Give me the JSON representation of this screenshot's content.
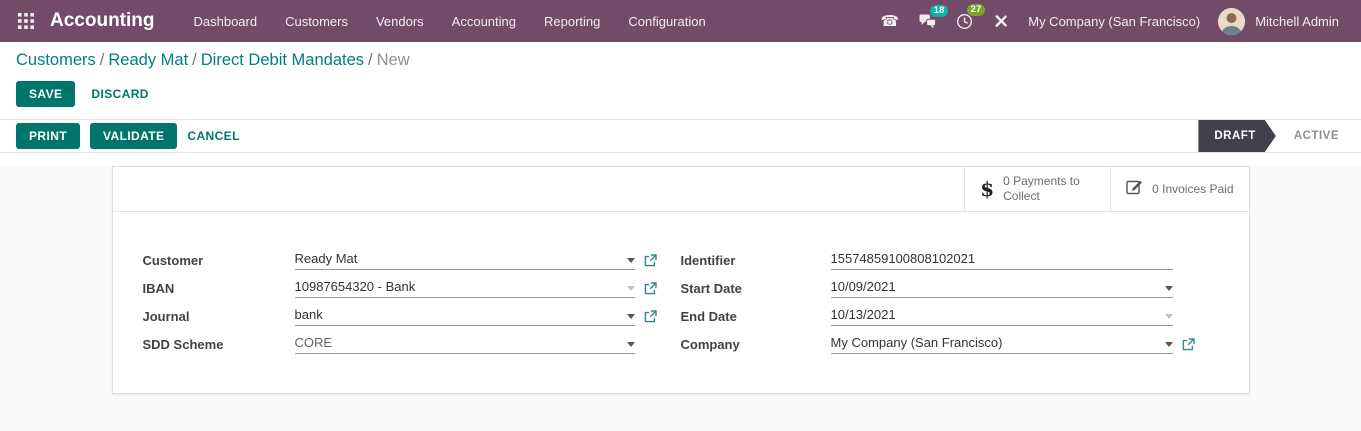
{
  "navbar": {
    "app_name": "Accounting",
    "menus": [
      "Dashboard",
      "Customers",
      "Vendors",
      "Accounting",
      "Reporting",
      "Configuration"
    ],
    "badges": {
      "messages": "18",
      "activities": "27"
    },
    "company": "My Company (San Francisco)",
    "user": "Mitchell Admin"
  },
  "breadcrumb": {
    "links": [
      "Customers",
      "Ready Mat",
      "Direct Debit Mandates"
    ],
    "current": "New"
  },
  "form_actions": {
    "save": "SAVE",
    "discard": "DISCARD"
  },
  "statusbar": {
    "print": "PRINT",
    "validate": "VALIDATE",
    "cancel": "CANCEL",
    "states": {
      "draft": "DRAFT",
      "active": "ACTIVE"
    }
  },
  "stat_buttons": [
    {
      "icon": "dollar-icon",
      "label": "0 Payments to Collect"
    },
    {
      "icon": "edit-pencil-icon",
      "label": "0 Invoices Paid"
    }
  ],
  "fields": {
    "customer": {
      "label": "Customer",
      "value": "Ready Mat"
    },
    "iban": {
      "label": "IBAN",
      "value": "10987654320 - Bank"
    },
    "journal": {
      "label": "Journal",
      "value": "bank"
    },
    "sdd_scheme": {
      "label": "SDD Scheme",
      "value": "CORE"
    },
    "identifier": {
      "label": "Identifier",
      "value": "15574859100808102021"
    },
    "start_date": {
      "label": "Start Date",
      "value": "10/09/2021"
    },
    "end_date": {
      "label": "End Date",
      "value": "10/13/2021"
    },
    "company": {
      "label": "Company",
      "value": "My Company (San Francisco)"
    }
  },
  "colors": {
    "brand": "#714B67",
    "primary_button": "#00756b",
    "link": "#017e84",
    "draft_ribbon": "#40404e",
    "badge_messages": "#0db3a4",
    "badge_activities": "#7ba52a"
  }
}
